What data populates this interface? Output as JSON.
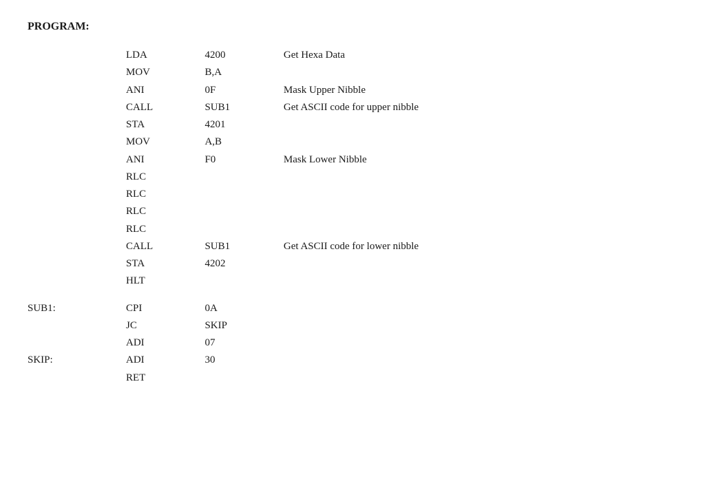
{
  "heading": "PROGRAM:",
  "rows": [
    {
      "label": "",
      "mnemonic": "LDA",
      "operand": "4200",
      "comment": "Get Hexa Data"
    },
    {
      "label": "",
      "mnemonic": "MOV",
      "operand": "B,A",
      "comment": ""
    },
    {
      "label": "",
      "mnemonic": "ANI",
      "operand": "0F",
      "comment": "Mask Upper Nibble"
    },
    {
      "label": "",
      "mnemonic": "CALL",
      "operand": "SUB1",
      "comment": "Get ASCII code for upper nibble"
    },
    {
      "label": "",
      "mnemonic": "STA",
      "operand": "4201",
      "comment": ""
    },
    {
      "label": "",
      "mnemonic": "MOV",
      "operand": "A,B",
      "comment": ""
    },
    {
      "label": "",
      "mnemonic": "ANI",
      "operand": "F0",
      "comment": "Mask Lower Nibble"
    },
    {
      "label": "",
      "mnemonic": "RLC",
      "operand": "",
      "comment": ""
    },
    {
      "label": "",
      "mnemonic": "RLC",
      "operand": "",
      "comment": ""
    },
    {
      "label": "",
      "mnemonic": "RLC",
      "operand": "",
      "comment": ""
    },
    {
      "label": "",
      "mnemonic": "RLC",
      "operand": "",
      "comment": ""
    },
    {
      "label": "",
      "mnemonic": "CALL",
      "operand": "SUB1",
      "comment": "Get ASCII code for lower nibble"
    },
    {
      "label": "",
      "mnemonic": "STA",
      "operand": "4202",
      "comment": ""
    },
    {
      "label": "",
      "mnemonic": "HLT",
      "operand": "",
      "comment": ""
    },
    {
      "label": "",
      "mnemonic": "",
      "operand": "",
      "comment": "",
      "empty": true
    },
    {
      "label": "SUB1:",
      "mnemonic": "CPI",
      "operand": "0A",
      "comment": ""
    },
    {
      "label": "",
      "mnemonic": "JC",
      "operand": "SKIP",
      "comment": ""
    },
    {
      "label": "",
      "mnemonic": "ADI",
      "operand": "07",
      "comment": ""
    },
    {
      "label": "SKIP:",
      "mnemonic": "ADI",
      "operand": "30",
      "comment": ""
    },
    {
      "label": "",
      "mnemonic": "RET",
      "operand": "",
      "comment": ""
    }
  ]
}
